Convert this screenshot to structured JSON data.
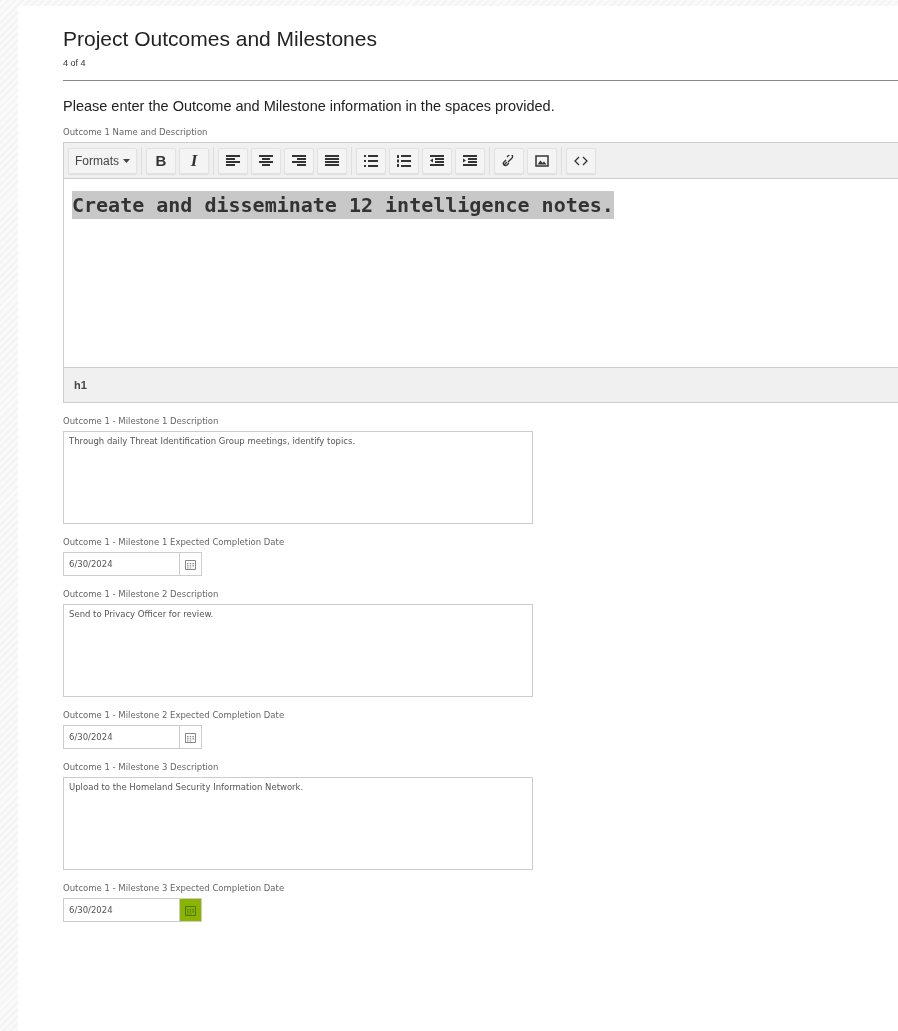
{
  "header": {
    "title": "Project Outcomes and Milestones",
    "step": "4 of 4"
  },
  "instruction": "Please enter the Outcome and Milestone information in the spaces provided.",
  "editor": {
    "label": "Outcome 1 Name and Description",
    "formats": "Formats",
    "groups": [
      [
        {
          "kind": "bold",
          "label": "B"
        },
        {
          "kind": "italic",
          "label": "I"
        }
      ],
      [
        {
          "kind": "align-left"
        },
        {
          "kind": "align-center"
        },
        {
          "kind": "align-right"
        },
        {
          "kind": "align-justify"
        }
      ],
      [
        {
          "kind": "bullet-list"
        },
        {
          "kind": "numbered-list"
        },
        {
          "kind": "outdent"
        },
        {
          "kind": "indent"
        }
      ],
      [
        {
          "kind": "link"
        },
        {
          "kind": "image"
        }
      ],
      [
        {
          "kind": "code"
        }
      ]
    ],
    "content": "Create and disseminate 12 intelligence notes.",
    "content_selected": true,
    "path": "h1"
  },
  "fields": [
    {
      "kind": "textarea",
      "label": "Outcome 1 - Milestone 1 Description",
      "value": "Through daily Threat Identification Group meetings, identify topics."
    },
    {
      "kind": "date",
      "label": "Outcome 1 - Milestone 1 Expected Completion Date",
      "value": "6/30/2024",
      "picker_active": false
    },
    {
      "kind": "textarea",
      "label": "Outcome 1 - Milestone 2 Description",
      "value": "Send to Privacy Officer for review."
    },
    {
      "kind": "date",
      "label": "Outcome 1 - Milestone 2 Expected Completion Date",
      "value": "6/30/2024",
      "picker_active": false
    },
    {
      "kind": "textarea",
      "label": "Outcome 1 - Milestone 3 Description",
      "value": "Upload to the Homeland Security Information Network."
    },
    {
      "kind": "date",
      "label": "Outcome 1 - Milestone 3 Expected Completion Date",
      "value": "6/30/2024",
      "picker_active": true
    }
  ]
}
